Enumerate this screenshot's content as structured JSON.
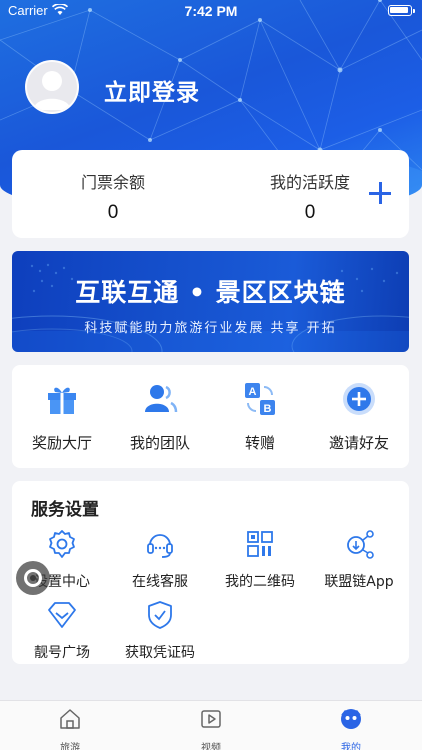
{
  "status_bar": {
    "carrier": "Carrier",
    "time": "7:42 PM"
  },
  "header": {
    "login_label": "立即登录"
  },
  "stats": {
    "tickets_label": "门票余额",
    "tickets_value": "0",
    "activity_label": "我的活跃度",
    "activity_value": "0"
  },
  "banner": {
    "title": "互联互通 • 景区区块链",
    "subtitle": "科技赋能助力旅游行业发展 共享 开拓"
  },
  "quick_actions": [
    {
      "label": "奖励大厅",
      "icon": "gift-icon"
    },
    {
      "label": "我的团队",
      "icon": "team-icon"
    },
    {
      "label": "转赠",
      "icon": "transfer-icon"
    },
    {
      "label": "邀请好友",
      "icon": "invite-icon"
    }
  ],
  "services": {
    "title": "服务设置",
    "items": [
      {
        "label": "设置中心",
        "icon": "settings-icon"
      },
      {
        "label": "在线客服",
        "icon": "headset-icon"
      },
      {
        "label": "我的二维码",
        "icon": "qrcode-icon"
      },
      {
        "label": "联盟链App",
        "icon": "chain-app-icon"
      },
      {
        "label": "靓号广场",
        "icon": "diamond-icon"
      },
      {
        "label": "获取凭证码",
        "icon": "shield-check-icon"
      }
    ]
  },
  "tabbar": {
    "items": [
      {
        "label": "旅游",
        "icon": "home-icon",
        "active": false
      },
      {
        "label": "视频",
        "icon": "video-icon",
        "active": false
      },
      {
        "label": "我的",
        "icon": "profile-icon",
        "active": true
      }
    ]
  },
  "colors": {
    "accent": "#2a64e5",
    "header_blue": "#1a57d9",
    "background": "#f1f2f6"
  }
}
